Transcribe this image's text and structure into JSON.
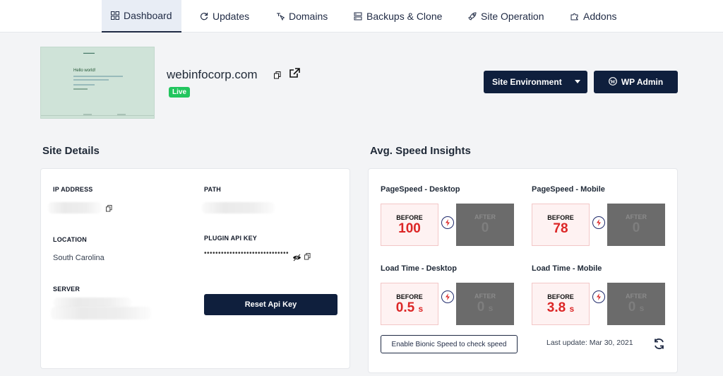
{
  "nav": {
    "tabs": [
      {
        "label": "Dashboard",
        "icon": "dashboard-icon"
      },
      {
        "label": "Updates",
        "icon": "refresh-icon"
      },
      {
        "label": "Domains",
        "icon": "cursor-icon"
      },
      {
        "label": "Backups & Clone",
        "icon": "server-icon"
      },
      {
        "label": "Site Operation",
        "icon": "rocket-icon"
      },
      {
        "label": "Addons",
        "icon": "puzzle-icon"
      }
    ],
    "active": "Dashboard"
  },
  "site": {
    "thumbnail_heading": "Hello world!",
    "domain": "webinfocorp.com",
    "status": "Live",
    "env_button": "Site Environment",
    "wp_button": "WP Admin"
  },
  "details": {
    "title": "Site Details",
    "ip_label": "IP ADDRESS",
    "path_label": "PATH",
    "location_label": "LOCATION",
    "location_value": "South Carolina",
    "api_key_label": "PLUGIN API KEY",
    "api_key_value": "••••••••••••••••••••••••••••••",
    "server_label": "SERVER",
    "reset_button": "Reset Api Key"
  },
  "speed": {
    "title": "Avg. Speed Insights",
    "before_label": "BEFORE",
    "after_label": "AFTER",
    "pagespeed_desktop": {
      "title": "PageSpeed - Desktop",
      "before": "100",
      "after": "0"
    },
    "pagespeed_mobile": {
      "title": "PageSpeed - Mobile",
      "before": "78",
      "after": "0"
    },
    "load_desktop": {
      "title": "Load Time - Desktop",
      "before": "0.5",
      "after": "0",
      "unit": "s"
    },
    "load_mobile": {
      "title": "Load Time - Mobile",
      "before": "3.8",
      "after": "0",
      "unit": "s"
    },
    "bionic_button": "Enable Bionic Speed to check speed",
    "last_update": "Last update: Mar 30, 2021"
  },
  "colors": {
    "navy": "#0f1f3d",
    "live_green": "#22c55e",
    "before_red": "#dc2626",
    "after_gray": "#6b6b6b"
  }
}
